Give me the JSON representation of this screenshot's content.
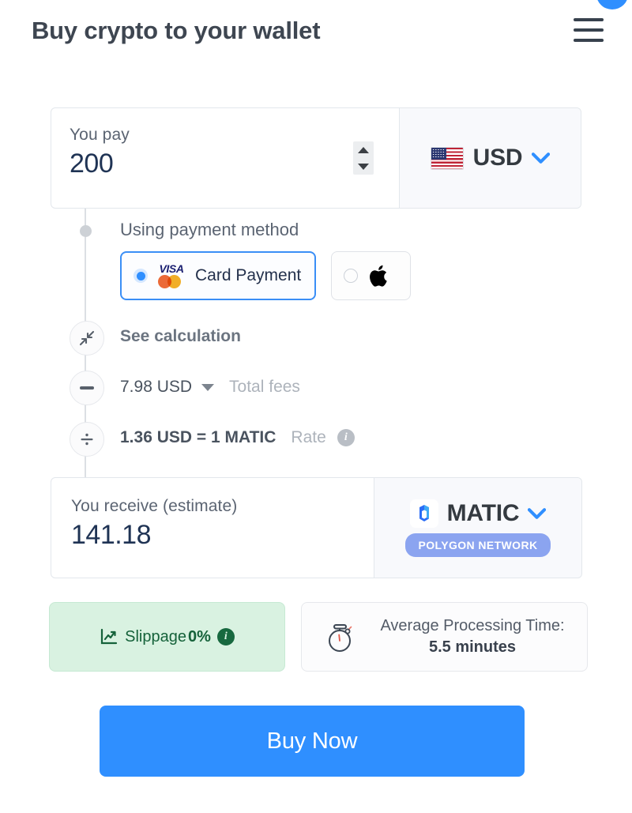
{
  "header": {
    "title": "Buy crypto to your wallet",
    "menu_icon": "hamburger-menu-icon"
  },
  "pay": {
    "label": "You pay",
    "amount": "200",
    "currency_code": "USD",
    "currency_flag": "us-flag-icon",
    "dropdown_icon": "chevron-down-icon",
    "stepper_icon": "up-down-stepper-icon"
  },
  "payment_method": {
    "label": "Using payment method",
    "options": [
      {
        "label": "Card Payment",
        "selected": true,
        "brands": [
          "VISA",
          "mastercard-icon"
        ],
        "radio_icon": "radio-selected-icon"
      },
      {
        "label": "",
        "selected": false,
        "brands": [
          "apple-pay-icon"
        ],
        "radio_icon": "radio-unselected-icon",
        "glyph": ""
      }
    ]
  },
  "calculation": {
    "see_calculation": "See calculation",
    "rows": [
      {
        "icon": "collapse-arrows-icon",
        "value": "",
        "label": ""
      },
      {
        "icon": "minus-icon",
        "value": "7.98 USD",
        "label": "Total fees",
        "caret": "caret-down-icon"
      },
      {
        "icon": "divide-icon",
        "value": "1.36 USD = 1 MATIC",
        "label": "Rate",
        "info": "i"
      }
    ]
  },
  "receive": {
    "label": "You receive (estimate)",
    "amount": "141.18",
    "currency_code": "MATIC",
    "currency_logo": "matic-logo-icon",
    "network_badge": "POLYGON NETWORK",
    "dropdown_icon": "chevron-down-icon"
  },
  "info_cards": {
    "slippage": {
      "icon": "chart-line-icon",
      "text_prefix": "Slippage ",
      "value": "0%",
      "info": "i"
    },
    "processing_time": {
      "icon": "stopwatch-icon",
      "title": "Average Processing Time:",
      "value": "5.5 minutes"
    }
  },
  "cta": {
    "label": "Buy Now"
  },
  "colors": {
    "accent_blue": "#2f8fff",
    "title_gray": "#3e4651",
    "value_navy": "#1f3354",
    "slippage_green_bg": "#d9f2e1",
    "slippage_green_text": "#15623a",
    "badge_purple": "#8ba4f0"
  }
}
